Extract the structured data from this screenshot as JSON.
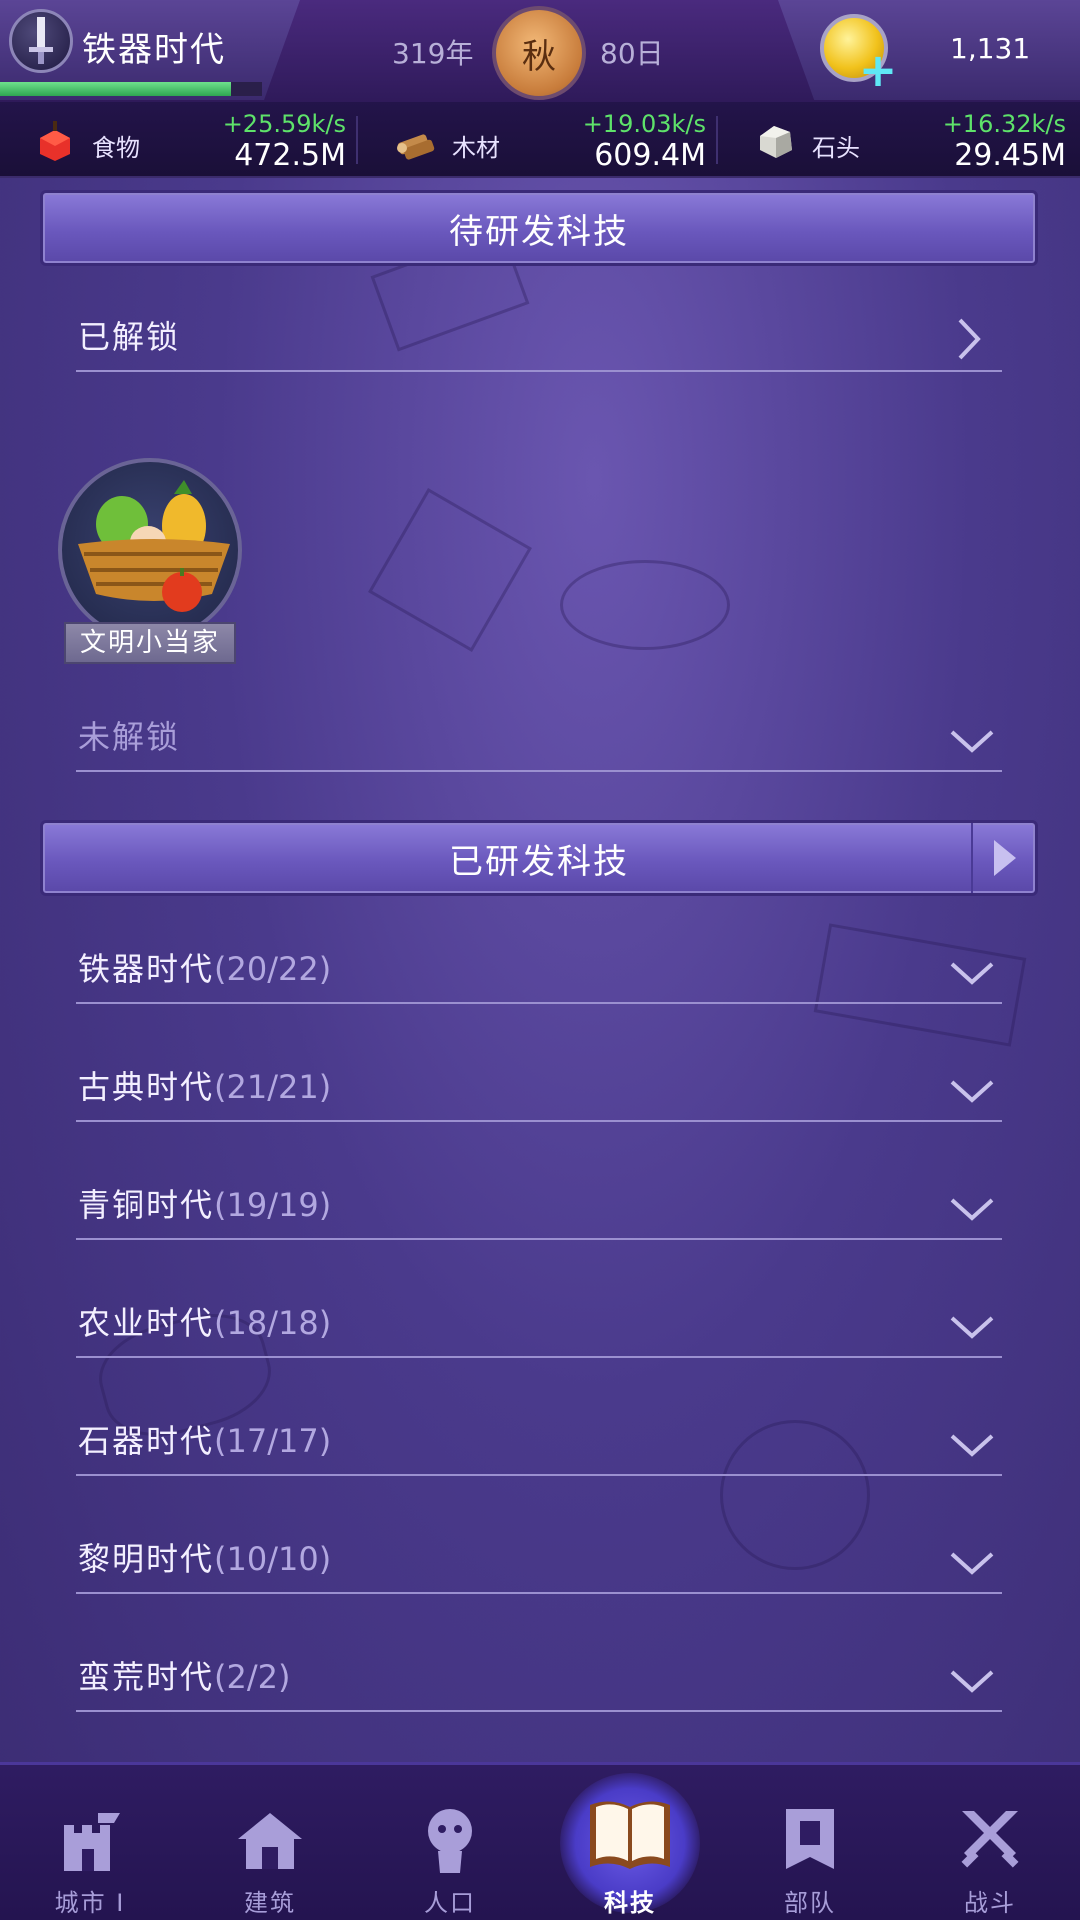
{
  "header": {
    "era_name": "铁器时代",
    "era_progress": 0.88,
    "year": "319年",
    "season": "秋",
    "day": "80日",
    "gold": "1,131"
  },
  "resources": [
    {
      "name": "食物",
      "rate": "+25.59k/s",
      "amount": "472.5M",
      "icon": "apple-icon"
    },
    {
      "name": "木材",
      "rate": "+19.03k/s",
      "amount": "609.4M",
      "icon": "wood-icon"
    },
    {
      "name": "石头",
      "rate": "+16.32k/s",
      "amount": "29.45M",
      "icon": "stone-icon"
    }
  ],
  "researchable": {
    "title": "待研发科技",
    "unlocked_label": "已解锁",
    "tech_item": {
      "name": "文明小当家",
      "icon": "fruit-basket-icon"
    },
    "locked_label": "未解锁"
  },
  "researched": {
    "title": "已研发科技",
    "eras": [
      {
        "name": "铁器时代",
        "count": "(20/22)"
      },
      {
        "name": "古典时代",
        "count": "(21/21)"
      },
      {
        "name": "青铜时代",
        "count": "(19/19)"
      },
      {
        "name": "农业时代",
        "count": "(18/18)"
      },
      {
        "name": "石器时代",
        "count": "(17/17)"
      },
      {
        "name": "黎明时代",
        "count": "(10/10)"
      },
      {
        "name": "蛮荒时代",
        "count": "(2/2)"
      }
    ]
  },
  "nav": [
    {
      "label": "城市 I",
      "icon": "castle-icon"
    },
    {
      "label": "建筑",
      "icon": "house-icon"
    },
    {
      "label": "人口",
      "icon": "person-icon"
    },
    {
      "label": "科技",
      "icon": "book-icon",
      "active": true
    },
    {
      "label": "部队",
      "icon": "banner-icon"
    },
    {
      "label": "战斗",
      "icon": "crossed-swords-icon"
    }
  ],
  "colors": {
    "accent": "#6a58bd",
    "rate_green": "#5ee26a",
    "background": "#4a3a8c"
  }
}
